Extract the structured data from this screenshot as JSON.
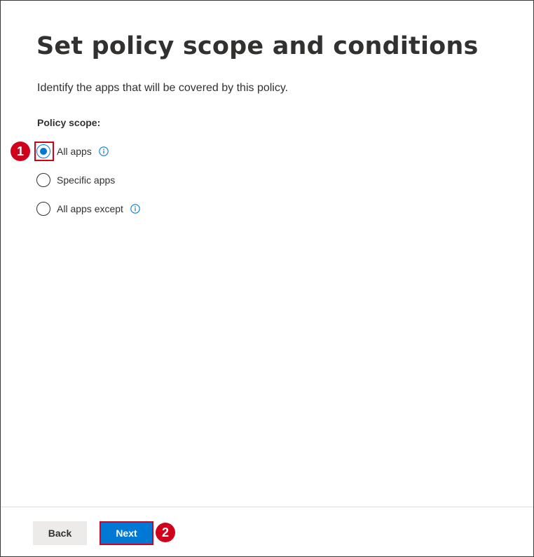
{
  "page": {
    "title": "Set policy scope and conditions",
    "description": "Identify the apps that will be covered by this policy."
  },
  "policy_scope": {
    "label": "Policy scope:",
    "options": [
      {
        "label": "All apps",
        "selected": true,
        "has_info": true
      },
      {
        "label": "Specific apps",
        "selected": false,
        "has_info": false
      },
      {
        "label": "All apps except",
        "selected": false,
        "has_info": true
      }
    ]
  },
  "annotations": {
    "step1": "1",
    "step2": "2"
  },
  "footer": {
    "back_label": "Back",
    "next_label": "Next"
  },
  "colors": {
    "accent": "#0078d4",
    "annotation_red": "#d0021b"
  }
}
